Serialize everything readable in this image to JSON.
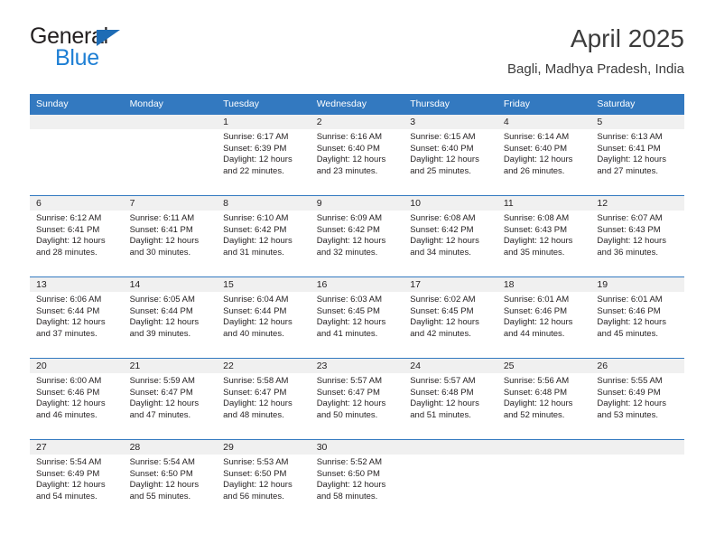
{
  "brand": {
    "name_top": "General",
    "name_bottom": "Blue",
    "accent_color": "#1e7fd4",
    "triangle_color": "#1e6cb5"
  },
  "header": {
    "title": "April 2025",
    "subtitle": "Bagli, Madhya Pradesh, India"
  },
  "theme": {
    "header_row_bg": "#3379c0",
    "daynum_strip_bg": "#f0f0f0",
    "text_color": "#231f20"
  },
  "weekday_headers": [
    "Sunday",
    "Monday",
    "Tuesday",
    "Wednesday",
    "Thursday",
    "Friday",
    "Saturday"
  ],
  "weeks": [
    [
      {
        "day": "",
        "sunrise": "",
        "sunset": "",
        "daylight_1": "",
        "daylight_2": ""
      },
      {
        "day": "",
        "sunrise": "",
        "sunset": "",
        "daylight_1": "",
        "daylight_2": ""
      },
      {
        "day": "1",
        "sunrise": "Sunrise: 6:17 AM",
        "sunset": "Sunset: 6:39 PM",
        "daylight_1": "Daylight: 12 hours",
        "daylight_2": "and 22 minutes."
      },
      {
        "day": "2",
        "sunrise": "Sunrise: 6:16 AM",
        "sunset": "Sunset: 6:40 PM",
        "daylight_1": "Daylight: 12 hours",
        "daylight_2": "and 23 minutes."
      },
      {
        "day": "3",
        "sunrise": "Sunrise: 6:15 AM",
        "sunset": "Sunset: 6:40 PM",
        "daylight_1": "Daylight: 12 hours",
        "daylight_2": "and 25 minutes."
      },
      {
        "day": "4",
        "sunrise": "Sunrise: 6:14 AM",
        "sunset": "Sunset: 6:40 PM",
        "daylight_1": "Daylight: 12 hours",
        "daylight_2": "and 26 minutes."
      },
      {
        "day": "5",
        "sunrise": "Sunrise: 6:13 AM",
        "sunset": "Sunset: 6:41 PM",
        "daylight_1": "Daylight: 12 hours",
        "daylight_2": "and 27 minutes."
      }
    ],
    [
      {
        "day": "6",
        "sunrise": "Sunrise: 6:12 AM",
        "sunset": "Sunset: 6:41 PM",
        "daylight_1": "Daylight: 12 hours",
        "daylight_2": "and 28 minutes."
      },
      {
        "day": "7",
        "sunrise": "Sunrise: 6:11 AM",
        "sunset": "Sunset: 6:41 PM",
        "daylight_1": "Daylight: 12 hours",
        "daylight_2": "and 30 minutes."
      },
      {
        "day": "8",
        "sunrise": "Sunrise: 6:10 AM",
        "sunset": "Sunset: 6:42 PM",
        "daylight_1": "Daylight: 12 hours",
        "daylight_2": "and 31 minutes."
      },
      {
        "day": "9",
        "sunrise": "Sunrise: 6:09 AM",
        "sunset": "Sunset: 6:42 PM",
        "daylight_1": "Daylight: 12 hours",
        "daylight_2": "and 32 minutes."
      },
      {
        "day": "10",
        "sunrise": "Sunrise: 6:08 AM",
        "sunset": "Sunset: 6:42 PM",
        "daylight_1": "Daylight: 12 hours",
        "daylight_2": "and 34 minutes."
      },
      {
        "day": "11",
        "sunrise": "Sunrise: 6:08 AM",
        "sunset": "Sunset: 6:43 PM",
        "daylight_1": "Daylight: 12 hours",
        "daylight_2": "and 35 minutes."
      },
      {
        "day": "12",
        "sunrise": "Sunrise: 6:07 AM",
        "sunset": "Sunset: 6:43 PM",
        "daylight_1": "Daylight: 12 hours",
        "daylight_2": "and 36 minutes."
      }
    ],
    [
      {
        "day": "13",
        "sunrise": "Sunrise: 6:06 AM",
        "sunset": "Sunset: 6:44 PM",
        "daylight_1": "Daylight: 12 hours",
        "daylight_2": "and 37 minutes."
      },
      {
        "day": "14",
        "sunrise": "Sunrise: 6:05 AM",
        "sunset": "Sunset: 6:44 PM",
        "daylight_1": "Daylight: 12 hours",
        "daylight_2": "and 39 minutes."
      },
      {
        "day": "15",
        "sunrise": "Sunrise: 6:04 AM",
        "sunset": "Sunset: 6:44 PM",
        "daylight_1": "Daylight: 12 hours",
        "daylight_2": "and 40 minutes."
      },
      {
        "day": "16",
        "sunrise": "Sunrise: 6:03 AM",
        "sunset": "Sunset: 6:45 PM",
        "daylight_1": "Daylight: 12 hours",
        "daylight_2": "and 41 minutes."
      },
      {
        "day": "17",
        "sunrise": "Sunrise: 6:02 AM",
        "sunset": "Sunset: 6:45 PM",
        "daylight_1": "Daylight: 12 hours",
        "daylight_2": "and 42 minutes."
      },
      {
        "day": "18",
        "sunrise": "Sunrise: 6:01 AM",
        "sunset": "Sunset: 6:46 PM",
        "daylight_1": "Daylight: 12 hours",
        "daylight_2": "and 44 minutes."
      },
      {
        "day": "19",
        "sunrise": "Sunrise: 6:01 AM",
        "sunset": "Sunset: 6:46 PM",
        "daylight_1": "Daylight: 12 hours",
        "daylight_2": "and 45 minutes."
      }
    ],
    [
      {
        "day": "20",
        "sunrise": "Sunrise: 6:00 AM",
        "sunset": "Sunset: 6:46 PM",
        "daylight_1": "Daylight: 12 hours",
        "daylight_2": "and 46 minutes."
      },
      {
        "day": "21",
        "sunrise": "Sunrise: 5:59 AM",
        "sunset": "Sunset: 6:47 PM",
        "daylight_1": "Daylight: 12 hours",
        "daylight_2": "and 47 minutes."
      },
      {
        "day": "22",
        "sunrise": "Sunrise: 5:58 AM",
        "sunset": "Sunset: 6:47 PM",
        "daylight_1": "Daylight: 12 hours",
        "daylight_2": "and 48 minutes."
      },
      {
        "day": "23",
        "sunrise": "Sunrise: 5:57 AM",
        "sunset": "Sunset: 6:47 PM",
        "daylight_1": "Daylight: 12 hours",
        "daylight_2": "and 50 minutes."
      },
      {
        "day": "24",
        "sunrise": "Sunrise: 5:57 AM",
        "sunset": "Sunset: 6:48 PM",
        "daylight_1": "Daylight: 12 hours",
        "daylight_2": "and 51 minutes."
      },
      {
        "day": "25",
        "sunrise": "Sunrise: 5:56 AM",
        "sunset": "Sunset: 6:48 PM",
        "daylight_1": "Daylight: 12 hours",
        "daylight_2": "and 52 minutes."
      },
      {
        "day": "26",
        "sunrise": "Sunrise: 5:55 AM",
        "sunset": "Sunset: 6:49 PM",
        "daylight_1": "Daylight: 12 hours",
        "daylight_2": "and 53 minutes."
      }
    ],
    [
      {
        "day": "27",
        "sunrise": "Sunrise: 5:54 AM",
        "sunset": "Sunset: 6:49 PM",
        "daylight_1": "Daylight: 12 hours",
        "daylight_2": "and 54 minutes."
      },
      {
        "day": "28",
        "sunrise": "Sunrise: 5:54 AM",
        "sunset": "Sunset: 6:50 PM",
        "daylight_1": "Daylight: 12 hours",
        "daylight_2": "and 55 minutes."
      },
      {
        "day": "29",
        "sunrise": "Sunrise: 5:53 AM",
        "sunset": "Sunset: 6:50 PM",
        "daylight_1": "Daylight: 12 hours",
        "daylight_2": "and 56 minutes."
      },
      {
        "day": "30",
        "sunrise": "Sunrise: 5:52 AM",
        "sunset": "Sunset: 6:50 PM",
        "daylight_1": "Daylight: 12 hours",
        "daylight_2": "and 58 minutes."
      },
      {
        "day": "",
        "sunrise": "",
        "sunset": "",
        "daylight_1": "",
        "daylight_2": ""
      },
      {
        "day": "",
        "sunrise": "",
        "sunset": "",
        "daylight_1": "",
        "daylight_2": ""
      },
      {
        "day": "",
        "sunrise": "",
        "sunset": "",
        "daylight_1": "",
        "daylight_2": ""
      }
    ]
  ]
}
